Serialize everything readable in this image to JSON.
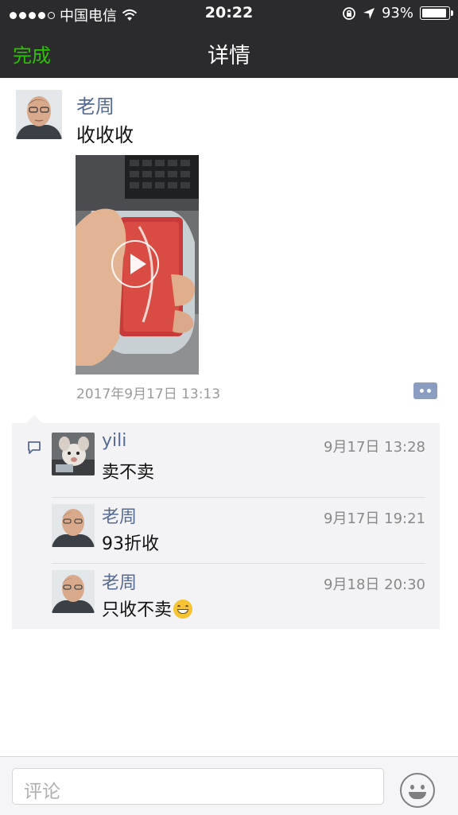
{
  "status_bar": {
    "carrier": "中国电信",
    "time": "20:22",
    "battery": "93%"
  },
  "nav": {
    "done_label": "完成",
    "title": "详情"
  },
  "post": {
    "author": "老周",
    "text": "收收收",
    "timestamp": "2017年9月17日 13:13"
  },
  "comments": [
    {
      "author": "yili",
      "time": "9月17日 13:28",
      "text": "卖不卖"
    },
    {
      "author": "老周",
      "time": "9月17日 19:21",
      "text": "93折收"
    },
    {
      "author": "老周",
      "time": "9月18日 20:30",
      "text": "只收不卖"
    }
  ],
  "input": {
    "placeholder": "评论"
  },
  "colors": {
    "accent_green": "#2dc100",
    "name_blue": "#566b94",
    "bar_dark": "#2b2b2e"
  },
  "icons": [
    "wifi-icon",
    "lock-rotation-icon",
    "location-arrow-icon",
    "battery-icon",
    "play-icon",
    "comment-more-icon",
    "comment-bubble-icon",
    "smiley-icon",
    "grin-emoji-icon"
  ]
}
